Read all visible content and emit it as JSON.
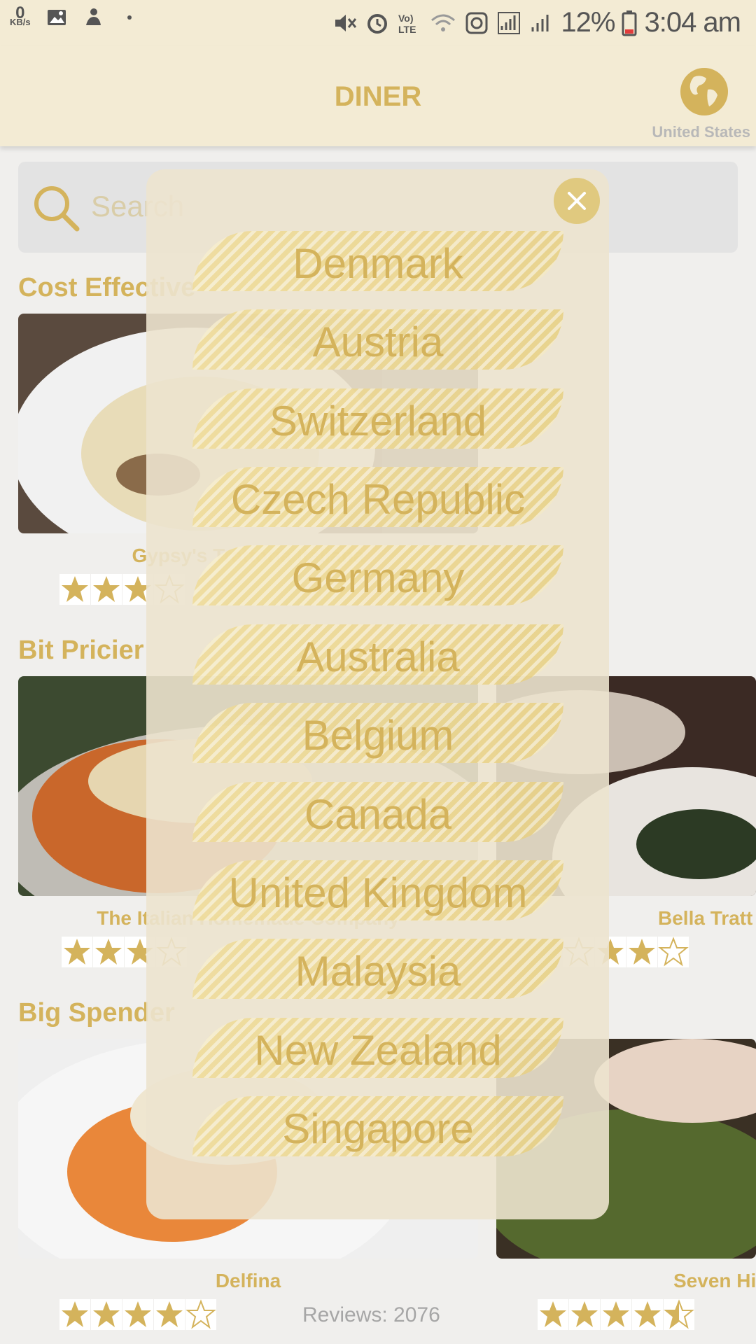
{
  "status_bar": {
    "kbs_value": "0",
    "kbs_unit": "KB/s",
    "battery_pct": "12%",
    "time": "3:04 am"
  },
  "header": {
    "title": "DINER",
    "region_label": "United States"
  },
  "search": {
    "placeholder": "Search"
  },
  "sections": {
    "cost_effective": "Cost Effective",
    "bit_pricier": "Bit Pricier",
    "big_spender": "Big Spender"
  },
  "restaurants": {
    "r1": {
      "name": "Gypsy's Trattoria Italiana",
      "rating": 3
    },
    "r2": {
      "name": "The Italian Homemade Company",
      "rating": 3.5
    },
    "r3": {
      "name": "Bella Tratt",
      "rating": 4
    },
    "r4": {
      "name": "Delfina",
      "rating": 4,
      "reviews": "Reviews: 2076"
    },
    "r5": {
      "name": "Seven Hi",
      "rating": 4.5
    }
  },
  "country_picker": {
    "countries": [
      "Denmark",
      "Austria",
      "Switzerland",
      "Czech Republic",
      "Germany",
      "Australia",
      "Belgium",
      "Canada",
      "United Kingdom",
      "Malaysia",
      "New Zealand",
      "Singapore"
    ]
  },
  "colors": {
    "accent": "#d4b35c",
    "header_bg": "#f3ebd4",
    "page_bg": "#f0efed"
  }
}
